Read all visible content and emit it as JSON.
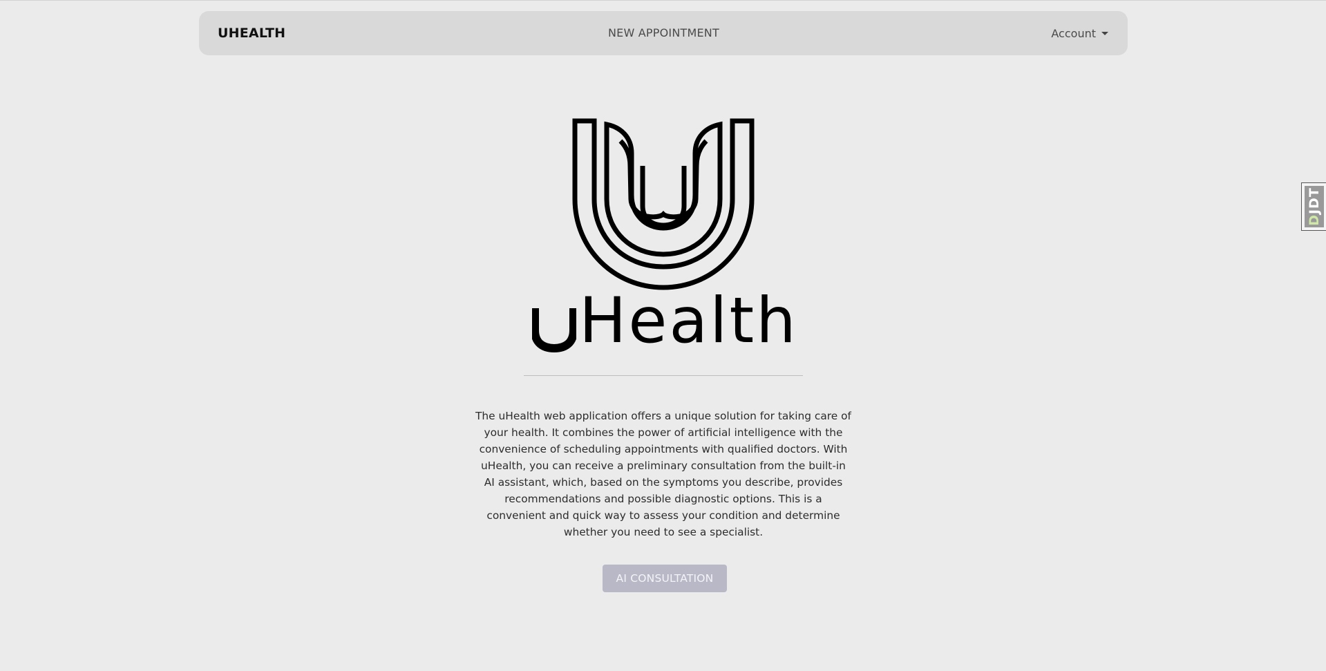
{
  "navbar": {
    "brand": "UHEALTH",
    "new_appointment": "NEW APPOINTMENT",
    "account": "Account"
  },
  "hero": {
    "logo_text": "UHealth",
    "description": "The uHealth web application offers a unique solution for taking care of your health. It combines the power of artificial intelligence with the convenience of scheduling appointments with qualified doctors. With uHealth, you can receive a preliminary consultation from the built-in AI assistant, which, based on the symptoms you describe, provides recommendations and possible diagnostic options. This is a convenient and quick way to assess your condition and determine whether you need to see a specialist.",
    "ai_button": "AI CONSULTATION"
  },
  "debug_toolbar": {
    "label_first": "D",
    "label_rest": "JDT"
  },
  "colors": {
    "background": "#ebebeb",
    "navbar": "#d9d9d9",
    "button": "#b8b8c6",
    "logo": "#000000"
  },
  "icons": {
    "account_dropdown": "caret-down-icon",
    "logo": "uhealth-logo"
  }
}
